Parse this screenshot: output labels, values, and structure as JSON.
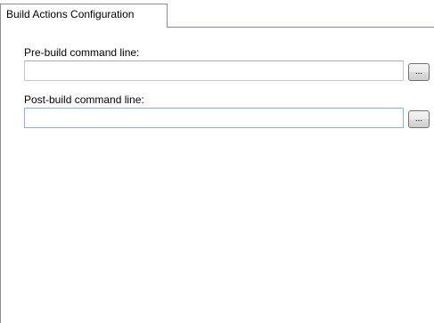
{
  "tabs": [
    {
      "label": "Build Actions Configuration",
      "selected": true
    }
  ],
  "pre_build": {
    "label": "Pre-build command line:",
    "value": "",
    "browse_label": "..."
  },
  "post_build": {
    "label": "Post-build command line:",
    "value": "",
    "browse_label": "...",
    "focused": true
  },
  "colors": {
    "tab_border": "#898c95",
    "input_border": "#c5c9d2",
    "focused_input_border": "#7eb4ea",
    "button_border": "#707070"
  }
}
